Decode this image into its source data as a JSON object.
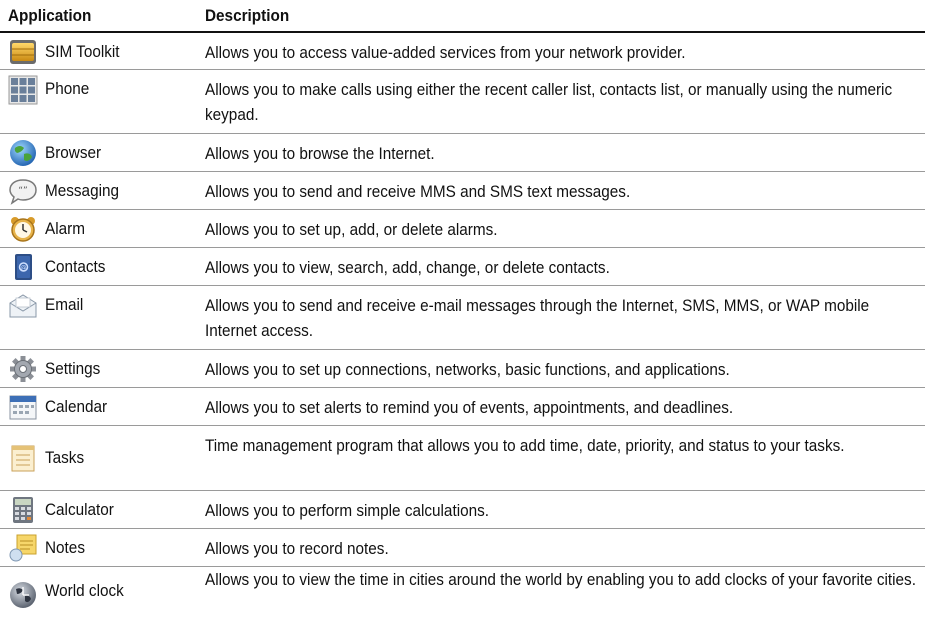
{
  "header": {
    "application": "Application",
    "description": "Description"
  },
  "rows": [
    {
      "icon": "sim-card-icon",
      "name": "SIM Toolkit",
      "description": "Allows you to access value-added services from your network provider."
    },
    {
      "icon": "keypad-icon",
      "name": "Phone",
      "description": "Allows you to make calls using either the recent caller list, contacts list, or manually using the numeric keypad."
    },
    {
      "icon": "globe-icon",
      "name": "Browser",
      "description": "Allows you to browse the Internet."
    },
    {
      "icon": "speech-bubble-icon",
      "name": "Messaging",
      "description": "Allows you to send and receive MMS and SMS text messages."
    },
    {
      "icon": "alarm-clock-icon",
      "name": "Alarm",
      "description": "Allows you to set up, add, or delete alarms."
    },
    {
      "icon": "contacts-book-icon",
      "name": "Contacts",
      "description": "Allows you to view, search, add, change, or delete contacts."
    },
    {
      "icon": "envelope-icon",
      "name": "Email",
      "description": "Allows you to send and receive e-mail messages through the Internet, SMS, MMS, or WAP mobile Internet access."
    },
    {
      "icon": "gear-icon",
      "name": "Settings",
      "description": "Allows you to set up connections, networks, basic functions, and applications."
    },
    {
      "icon": "calendar-icon",
      "name": "Calendar",
      "description": "Allows you to set alerts to remind you of events, appointments, and deadlines."
    },
    {
      "icon": "task-list-icon",
      "name": "Tasks",
      "description": "Time management program that allows you to add time, date, priority, and status to your tasks."
    },
    {
      "icon": "calculator-icon",
      "name": "Calculator",
      "description": "Allows you to perform simple calculations."
    },
    {
      "icon": "notes-icon",
      "name": "Notes",
      "description": "Allows you to record notes."
    },
    {
      "icon": "world-clock-icon",
      "name": "World clock",
      "description": "Allows you to view the time in cities around the world by enabling you to add clocks of your favorite cities."
    }
  ]
}
